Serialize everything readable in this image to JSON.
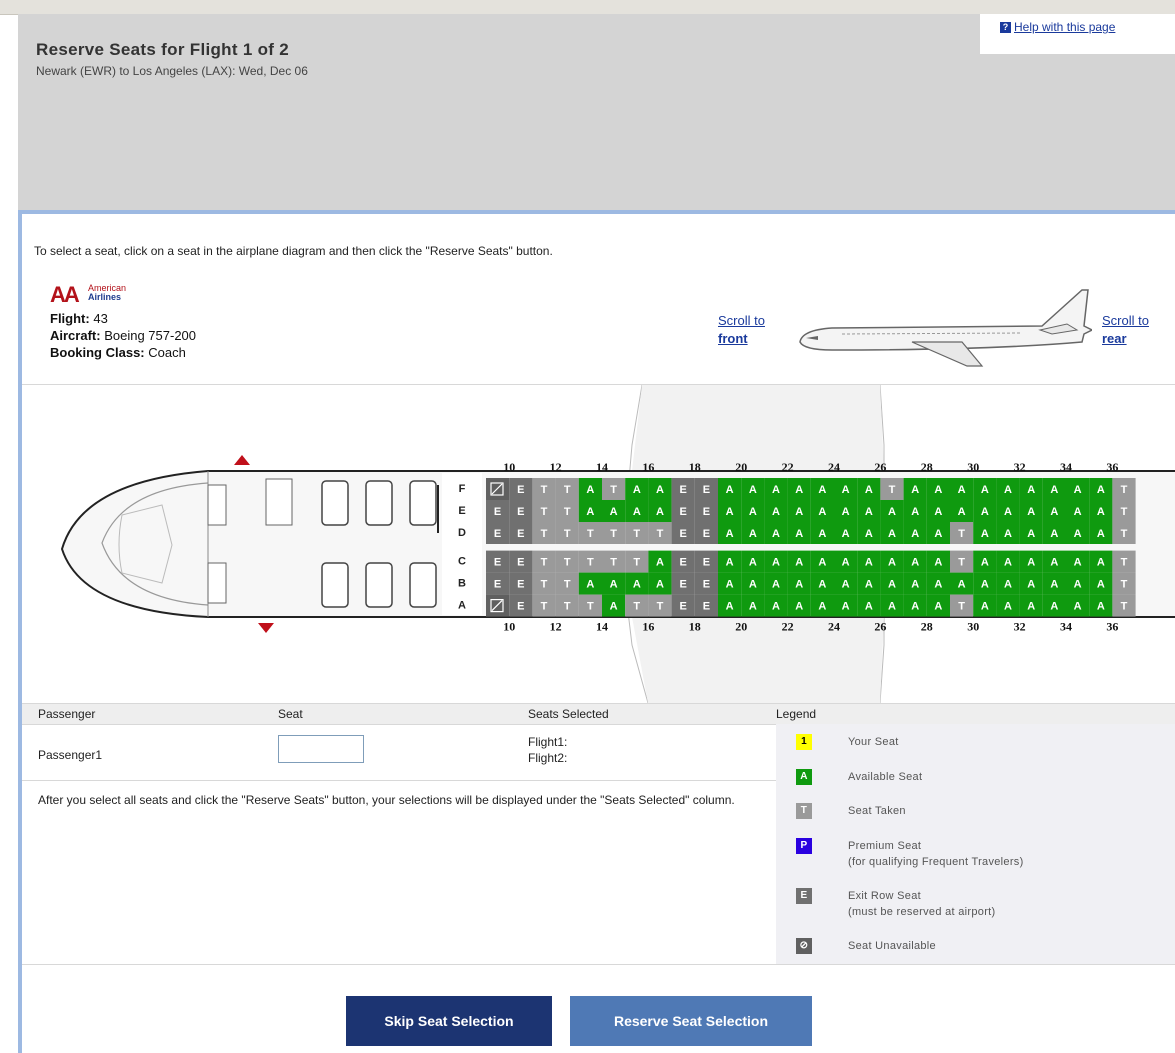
{
  "header": {
    "title": "Reserve Seats for Flight 1 of 2",
    "route": "Newark (EWR) to Los Angeles (LAX): Wed, Dec 06",
    "help_link": "Help with this page"
  },
  "instruction": "To select a seat, click on a seat in the airplane diagram and then click the \"Reserve Seats\" button.",
  "airline": {
    "logo_letters": "AA",
    "name_line1": "American",
    "name_line2": "Airlines",
    "flight_label": "Flight:",
    "flight_value": "43",
    "aircraft_label": "Aircraft:",
    "aircraft_value": "Boeing 757-200",
    "class_label": "Booking Class:",
    "class_value": "Coach"
  },
  "scroll": {
    "front_line1": "Scroll to",
    "front_line2": "front",
    "rear_line1": "Scroll to",
    "rear_line2": "rear"
  },
  "seatmap": {
    "row_labels": [
      "10",
      "12",
      "14",
      "16",
      "18",
      "20",
      "22",
      "24",
      "26",
      "28",
      "30",
      "32",
      "34",
      "36"
    ],
    "letters": [
      "F",
      "E",
      "D",
      "C",
      "B",
      "A"
    ],
    "columns": [
      [
        "U",
        "E",
        "E",
        "E",
        "E",
        "U"
      ],
      [
        "E",
        "E",
        "E",
        "E",
        "E",
        "E"
      ],
      [
        "T",
        "T",
        "T",
        "T",
        "T",
        "T"
      ],
      [
        "T",
        "T",
        "T",
        "T",
        "T",
        "T"
      ],
      [
        "A",
        "A",
        "T",
        "T",
        "A",
        "T"
      ],
      [
        "T",
        "A",
        "T",
        "T",
        "A",
        "A"
      ],
      [
        "A",
        "A",
        "T",
        "T",
        "A",
        "T"
      ],
      [
        "A",
        "A",
        "T",
        "A",
        "A",
        "T"
      ],
      [
        "E",
        "E",
        "E",
        "E",
        "E",
        "E"
      ],
      [
        "E",
        "E",
        "E",
        "E",
        "E",
        "E"
      ],
      [
        "A",
        "A",
        "A",
        "A",
        "A",
        "A"
      ],
      [
        "A",
        "A",
        "A",
        "A",
        "A",
        "A"
      ],
      [
        "A",
        "A",
        "A",
        "A",
        "A",
        "A"
      ],
      [
        "A",
        "A",
        "A",
        "A",
        "A",
        "A"
      ],
      [
        "A",
        "A",
        "A",
        "A",
        "A",
        "A"
      ],
      [
        "A",
        "A",
        "A",
        "A",
        "A",
        "A"
      ],
      [
        "A",
        "A",
        "A",
        "A",
        "A",
        "A"
      ],
      [
        "T",
        "A",
        "A",
        "A",
        "A",
        "A"
      ],
      [
        "A",
        "A",
        "A",
        "A",
        "A",
        "A"
      ],
      [
        "A",
        "A",
        "A",
        "A",
        "A",
        "A"
      ],
      [
        "A",
        "A",
        "T",
        "T",
        "A",
        "T"
      ],
      [
        "A",
        "A",
        "A",
        "A",
        "A",
        "A"
      ],
      [
        "A",
        "A",
        "A",
        "A",
        "A",
        "A"
      ],
      [
        "A",
        "A",
        "A",
        "A",
        "A",
        "A"
      ],
      [
        "A",
        "A",
        "A",
        "A",
        "A",
        "A"
      ],
      [
        "A",
        "A",
        "A",
        "A",
        "A",
        "A"
      ],
      [
        "A",
        "A",
        "A",
        "A",
        "A",
        "A"
      ],
      [
        "T",
        "T",
        "T",
        "T",
        "T",
        "T"
      ]
    ],
    "colors": {
      "available": "#0f9a0f",
      "taken": "#9a9a9a",
      "exit": "#707070",
      "unavailable": "#606060"
    }
  },
  "table": {
    "col_passenger": "Passenger",
    "col_seat": "Seat",
    "col_selected": "Seats Selected",
    "col_legend": "Legend",
    "passenger_name": "Passenger1",
    "seat_value": "",
    "flight1": "Flight1:",
    "flight2": "Flight2:",
    "note": "After you select all seats and click the \"Reserve Seats\" button, your selections will be displayed under the \"Seats Selected\" column."
  },
  "legend": [
    {
      "swatch": "1",
      "label": "Your Seat",
      "sub": "",
      "bg": "#ffff00",
      "fg": "#000000"
    },
    {
      "swatch": "A",
      "label": "Available Seat",
      "sub": "",
      "bg": "#0f9a0f",
      "fg": "#ffffff"
    },
    {
      "swatch": "T",
      "label": "Seat Taken",
      "sub": "",
      "bg": "#9a9a9a",
      "fg": "#ffffff"
    },
    {
      "swatch": "P",
      "label": "Premium Seat",
      "sub": "(for qualifying Frequent Travelers)",
      "bg": "#2a00e0",
      "fg": "#ffffff"
    },
    {
      "swatch": "E",
      "label": "Exit Row Seat",
      "sub": "(must be reserved at airport)",
      "bg": "#707070",
      "fg": "#ffffff"
    },
    {
      "swatch": "⊘",
      "label": "Seat Unavailable",
      "sub": "",
      "bg": "#606060",
      "fg": "#ffffff"
    }
  ],
  "buttons": {
    "skip": "Skip Seat Selection",
    "reserve": "Reserve Seat Selection"
  }
}
